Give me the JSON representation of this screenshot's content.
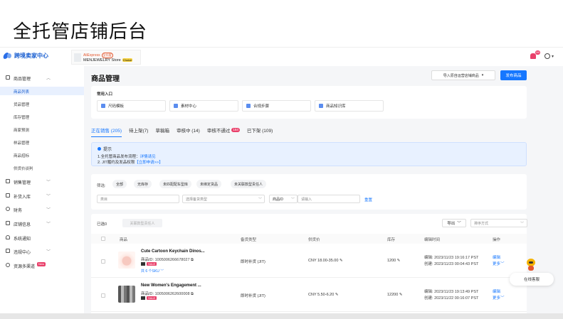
{
  "slide_title": "全托管店铺后台",
  "header": {
    "logo_text": "跨境卖家中心",
    "store_platform": "AliExpress",
    "store_badge": "全托管",
    "store_name": "MENJEWELRY Store",
    "store_choice": "Choice",
    "notification_count": "99"
  },
  "sidebar": {
    "sections": [
      {
        "label": "商品管理",
        "icon": "box-icon"
      },
      {
        "label": "销售管理",
        "icon": "sales-icon"
      },
      {
        "label": "补货入库",
        "icon": "inbound-icon"
      },
      {
        "label": "财务",
        "icon": "finance-icon"
      },
      {
        "label": "店铺信息",
        "icon": "store-icon"
      },
      {
        "label": "系统通知",
        "icon": "bell-icon"
      },
      {
        "label": "违规中心",
        "icon": "warning-icon"
      },
      {
        "label": "资源多渠道",
        "icon": "globe-icon",
        "badge": "New"
      }
    ],
    "sub_items": [
      "商品列表",
      "货品管理",
      "库存管理",
      "商家预测",
      "样品管理",
      "商品招标",
      "供货价谈判"
    ]
  },
  "main": {
    "title": "商品管理",
    "import_button": "导入原自运营店铺商品",
    "publish_button": "发布商品",
    "quick_title": "常用入口",
    "quick_links": [
      "尺码模板",
      "素材中心",
      "合规步骤",
      "商品知识库"
    ],
    "tabs": [
      {
        "label": "正在销售 (205)"
      },
      {
        "label": "待上架(7)"
      },
      {
        "label": "草稿箱"
      },
      {
        "label": "审核中 (14)"
      },
      {
        "label": "审核不通过",
        "badge": "164"
      },
      {
        "label": "已下架 (109)"
      }
    ],
    "tip": {
      "title": "提示",
      "line1_text": "1.全托管商品发布流程：",
      "line1_link": "详情请见",
      "line2_text": "2. JIT履约及发品权限",
      "line2_link": "【立即申请>>】"
    },
    "filter": {
      "label": "筛选:",
      "chips": [
        "全部",
        "无库存",
        "未匹配配车型库",
        "未绑定货品",
        "未关联款型责任人"
      ],
      "category_placeholder": "类目",
      "stock_type_placeholder": "选择备货类型",
      "search_type": "商品ID",
      "search_placeholder": "请输入",
      "reset": "重置"
    },
    "table": {
      "selected": "已选0",
      "batch_button": "关联款型责任人",
      "export_button": "导出",
      "sort_placeholder": "排序方式",
      "headers": [
        "商品",
        "备货类型",
        "供货价",
        "库存",
        "编辑时间",
        "操作"
      ],
      "rows": [
        {
          "name": "Cute Cartoon Keychain Dinos...",
          "id_label": "商品ID:",
          "id": "1005006266678027",
          "sale": "SALE",
          "sku": "共 6 个SKU",
          "stock_type": "即时补货 (JIT)",
          "price": "CNY  18.00-35.00",
          "stock": "1200",
          "edited_label": "编辑:",
          "edited": "2023/11/23 19:16:17 PST",
          "created_label": "创建:",
          "created": "2023/11/23 00:04:43 PST",
          "op1": "编辑",
          "op2": "更多"
        },
        {
          "name": "New Women's Engagement ...",
          "id_label": "商品ID:",
          "id": "1005006262600008",
          "sale": "SALE",
          "sku": "",
          "stock_type": "即时补货 (JIT)",
          "price": "CNY  5.50-6.20",
          "stock": "12200",
          "edited_label": "编辑:",
          "edited": "2023/11/23 19:13:49 PST",
          "created_label": "创建:",
          "created": "2023/11/22 00:16:07 PST",
          "op1": "编辑",
          "op2": "更多"
        }
      ]
    }
  },
  "chat": {
    "label": "在线客服"
  },
  "colors": {
    "primary": "#1677ff",
    "danger": "#e9406a",
    "sidebar_active_bg": "#e8f0fe"
  }
}
